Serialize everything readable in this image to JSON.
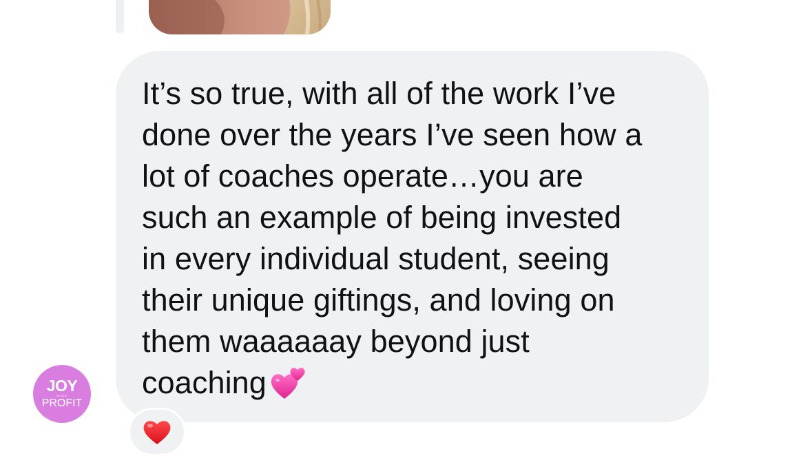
{
  "message": {
    "text": "It’s so true, with all of the work I’ve\ndone over the years I’ve seen how a\nlot of coaches operate…you are\nsuch an example of being invested\nin every individual student, seeing\ntheir unique giftings, and loving on\nthem waaaaaay beyond just\ncoaching",
    "emoji": "two-hearts-icon"
  },
  "avatar": {
    "line1": "JOY",
    "line2": "OVER",
    "line3": "PROFIT",
    "color": "#d97ee0"
  },
  "reaction": {
    "emoji": "red-heart-icon"
  },
  "colors": {
    "bubble": "#f0f1f3",
    "text": "#111111"
  }
}
